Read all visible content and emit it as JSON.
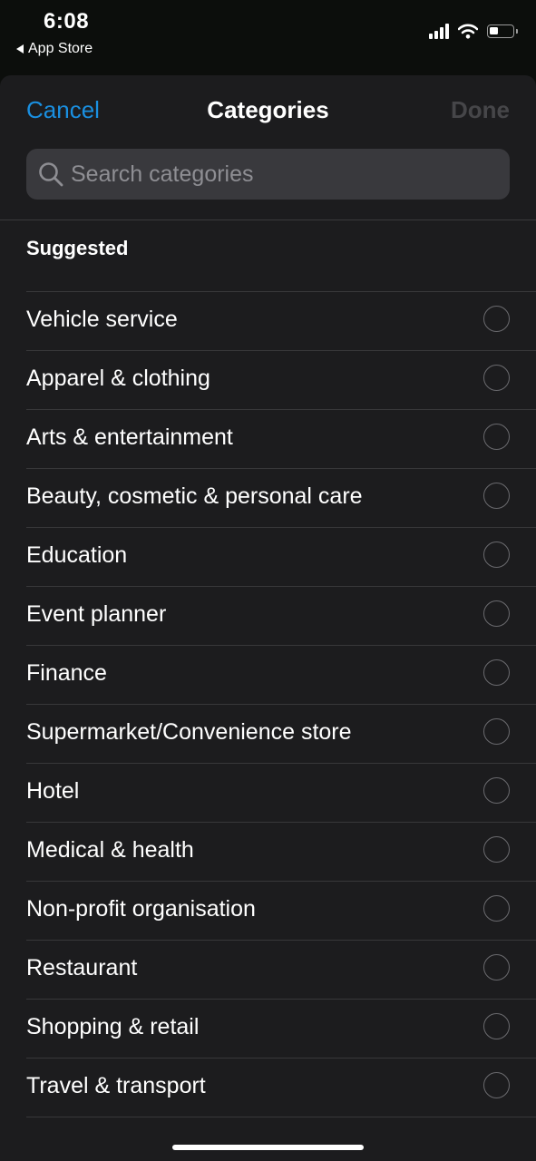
{
  "status_bar": {
    "time": "6:08",
    "back_app": "App Store"
  },
  "nav": {
    "cancel_label": "Cancel",
    "title": "Categories",
    "done_label": "Done"
  },
  "search": {
    "placeholder": "Search categories",
    "value": ""
  },
  "section": {
    "title": "Suggested"
  },
  "categories": [
    {
      "label": "Vehicle service",
      "selected": false
    },
    {
      "label": "Apparel & clothing",
      "selected": false
    },
    {
      "label": "Arts & entertainment",
      "selected": false
    },
    {
      "label": "Beauty, cosmetic & personal care",
      "selected": false
    },
    {
      "label": "Education",
      "selected": false
    },
    {
      "label": "Event planner",
      "selected": false
    },
    {
      "label": "Finance",
      "selected": false
    },
    {
      "label": "Supermarket/Convenience store",
      "selected": false
    },
    {
      "label": "Hotel",
      "selected": false
    },
    {
      "label": "Medical & health",
      "selected": false
    },
    {
      "label": "Non-profit organisation",
      "selected": false
    },
    {
      "label": "Restaurant",
      "selected": false
    },
    {
      "label": "Shopping & retail",
      "selected": false
    },
    {
      "label": "Travel & transport",
      "selected": false
    }
  ],
  "icons": {
    "signal": "cellular-signal-icon",
    "wifi": "wifi-icon",
    "battery": "battery-icon",
    "search": "magnifying-glass-icon",
    "back": "back-triangle-icon"
  },
  "colors": {
    "accent": "#1a8fe0",
    "sheet_background": "#1c1c1e",
    "search_background": "#39393d",
    "done_disabled": "#464649"
  }
}
